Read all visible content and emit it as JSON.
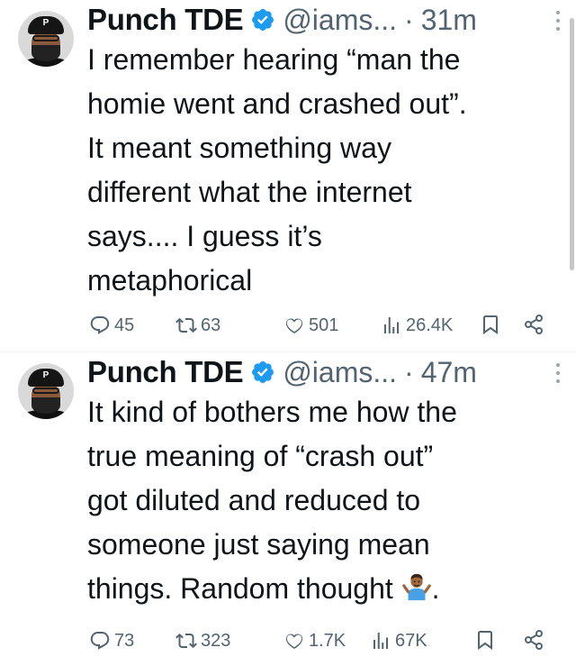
{
  "tweets": [
    {
      "name": "Punch TDE",
      "handle": "@iams...",
      "separator": "·",
      "time": "31m",
      "avatar_letter": "P",
      "text": "I remember hearing “man the\nhomie went and crashed out”.\nIt meant something way\ndifferent what the internet\nsays.... I guess it’s\nmetaphorical",
      "text_emoji": "",
      "text_end": "",
      "replies": "45",
      "reposts": "63",
      "likes": "501",
      "views": "26.4K"
    },
    {
      "name": "Punch TDE",
      "handle": "@iams...",
      "separator": "·",
      "time": "47m",
      "avatar_letter": "P",
      "text": "It kind of bothers me how the\ntrue meaning of “crash out”\ngot diluted and reduced to\nsomeone just saying mean\nthings. Random thought ",
      "text_emoji": "person-shrugging",
      "text_end": ".",
      "replies": "73",
      "reposts": "323",
      "likes": "1.7K",
      "views": "67K"
    }
  ],
  "icons": {
    "verified": "verified-badge-icon",
    "more": "more-options-icon",
    "reply": "reply-icon",
    "repost": "repost-icon",
    "like": "like-icon",
    "views": "views-icon",
    "bookmark": "bookmark-icon",
    "share": "share-icon"
  },
  "colors": {
    "text": "#0f1419",
    "secondary": "#536471",
    "verified": "#1d9bf0",
    "divider": "#eff3f4"
  }
}
